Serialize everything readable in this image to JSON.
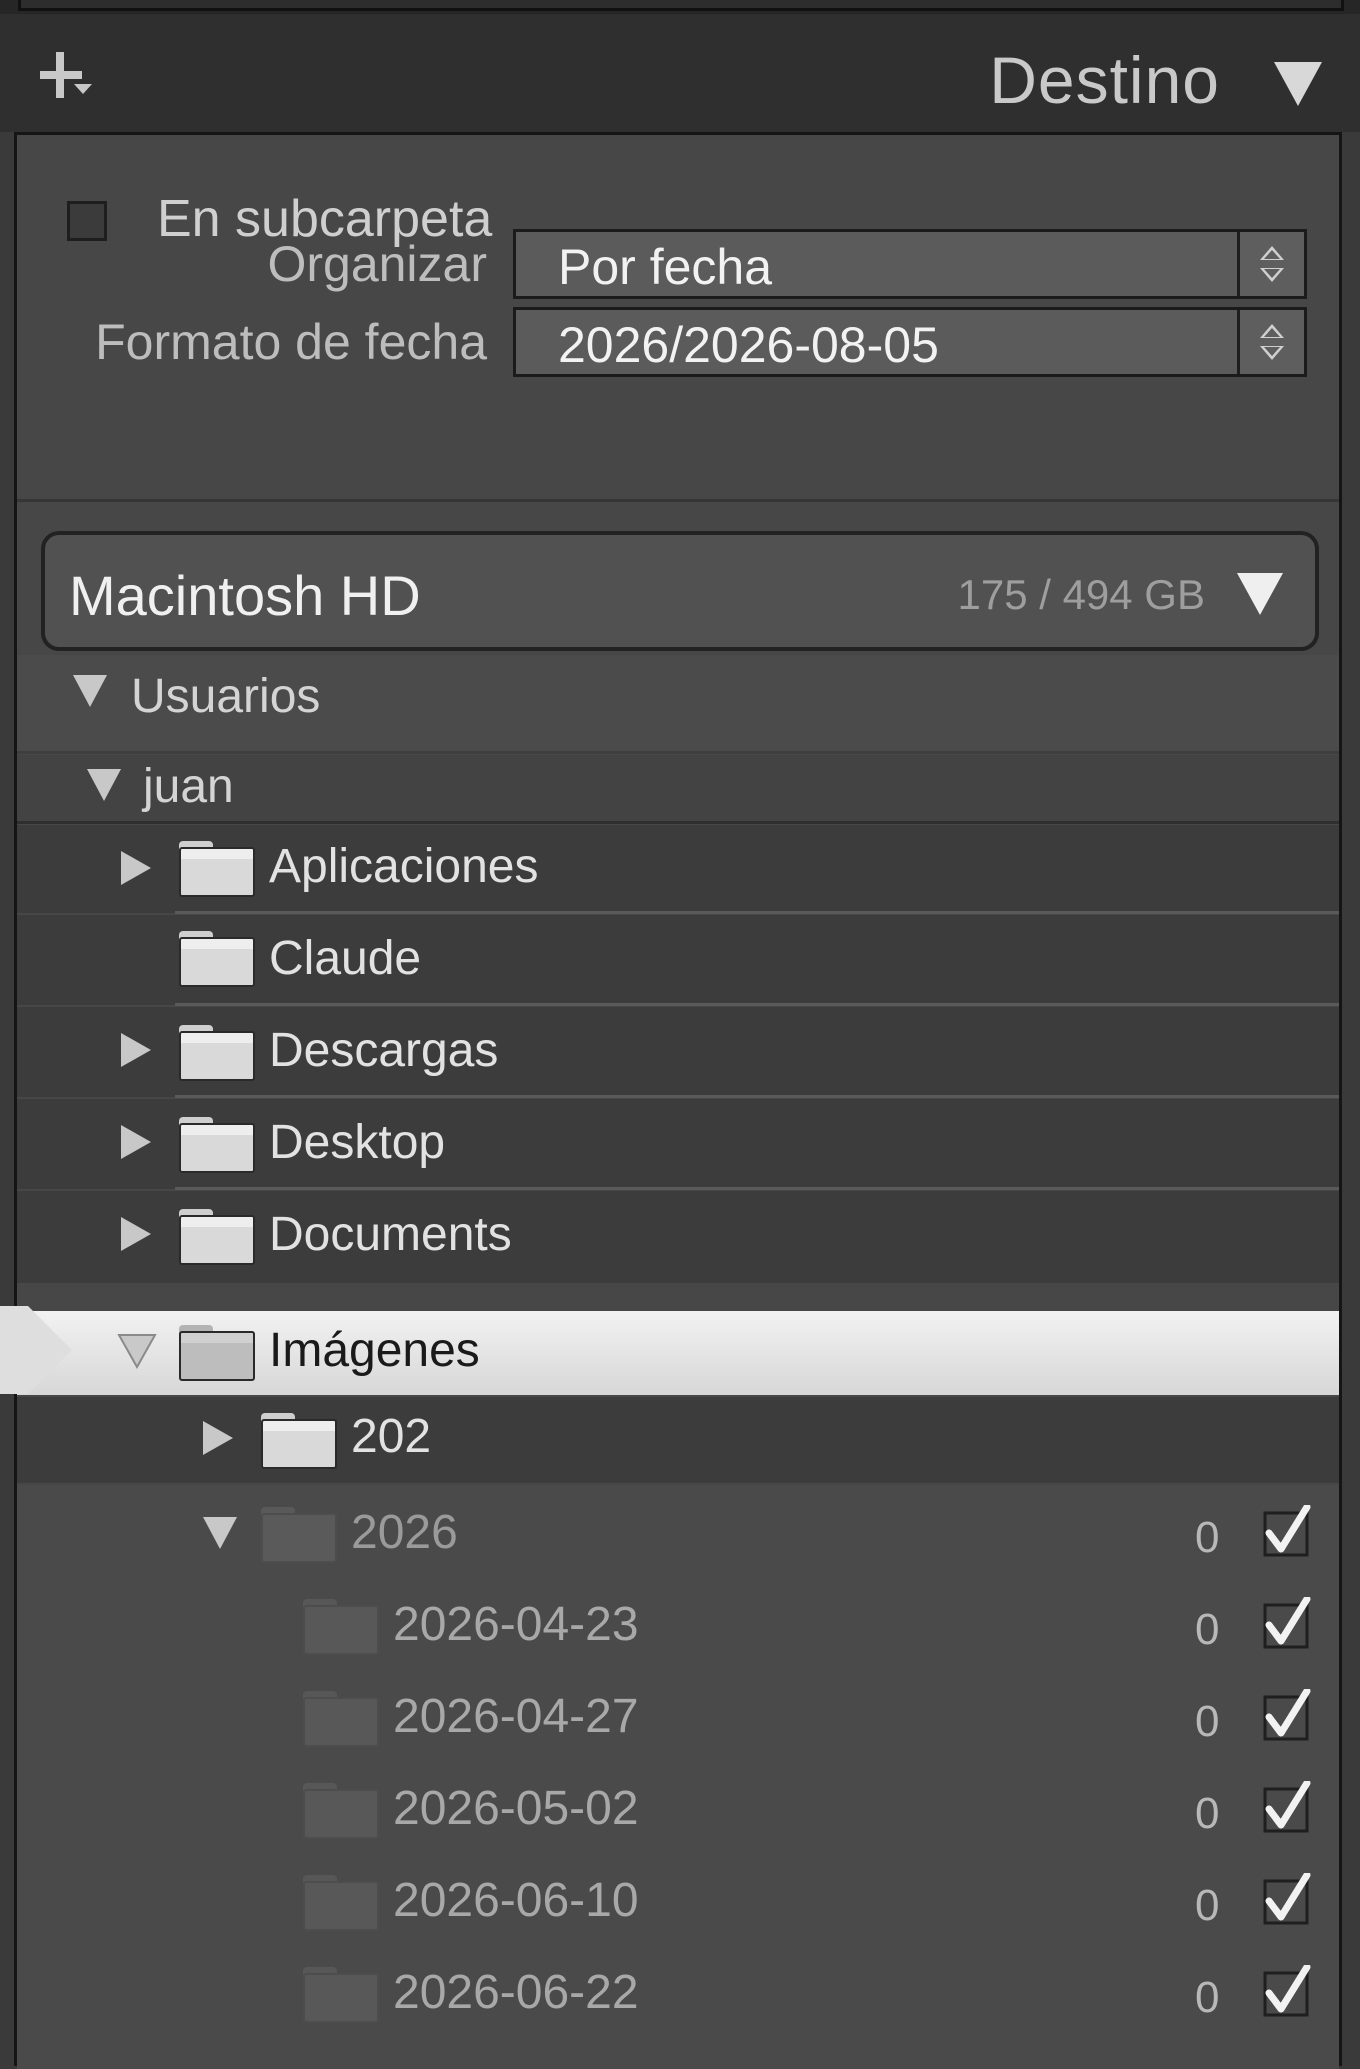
{
  "header": {
    "title": "Destino"
  },
  "options": {
    "subfolder_label": "En subcarpeta",
    "organize_label": "Organizar",
    "organize_value": "Por fecha",
    "date_format_label": "Formato de fecha",
    "date_format_value": "2026/2026-08-05"
  },
  "volume": {
    "name": "Macintosh HD",
    "usage": "175 / 494 GB"
  },
  "tree": {
    "users": "Usuarios",
    "user": "juan",
    "folders": [
      {
        "name": "Aplicaciones"
      },
      {
        "name": "Claude"
      },
      {
        "name": "Descargas"
      },
      {
        "name": "Desktop"
      },
      {
        "name": "Documents"
      },
      {
        "name": "Imágenes"
      },
      {
        "name": "202"
      },
      {
        "name": "2026",
        "count": "0"
      },
      {
        "name": "2026-04-23",
        "count": "0"
      },
      {
        "name": "2026-04-27",
        "count": "0"
      },
      {
        "name": "2026-05-02",
        "count": "0"
      },
      {
        "name": "2026-06-10",
        "count": "0"
      },
      {
        "name": "2026-06-22",
        "count": "0"
      }
    ]
  }
}
